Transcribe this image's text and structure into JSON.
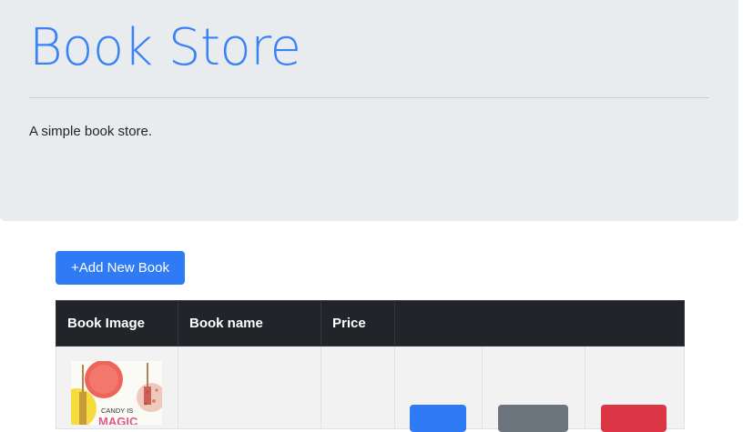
{
  "header": {
    "title": "Book Store",
    "tagline": "A simple book store."
  },
  "toolbar": {
    "add_label": "+Add New Book"
  },
  "table": {
    "columns": [
      "Book Image",
      "Book name",
      "Price",
      ""
    ],
    "rows": [
      {
        "cover_text": "CANDY IS",
        "cover_text_2": "MAGIC",
        "name": "",
        "price": "",
        "edit_label": "",
        "view_label": "",
        "delete_label": ""
      }
    ]
  },
  "colors": {
    "primary": "#2f7bf5",
    "secondary": "#6c757d",
    "danger": "#dc3545",
    "dark": "#212529",
    "jumbotron": "#e9ecef"
  },
  "icons": {
    "cover": "book-cover-image"
  }
}
